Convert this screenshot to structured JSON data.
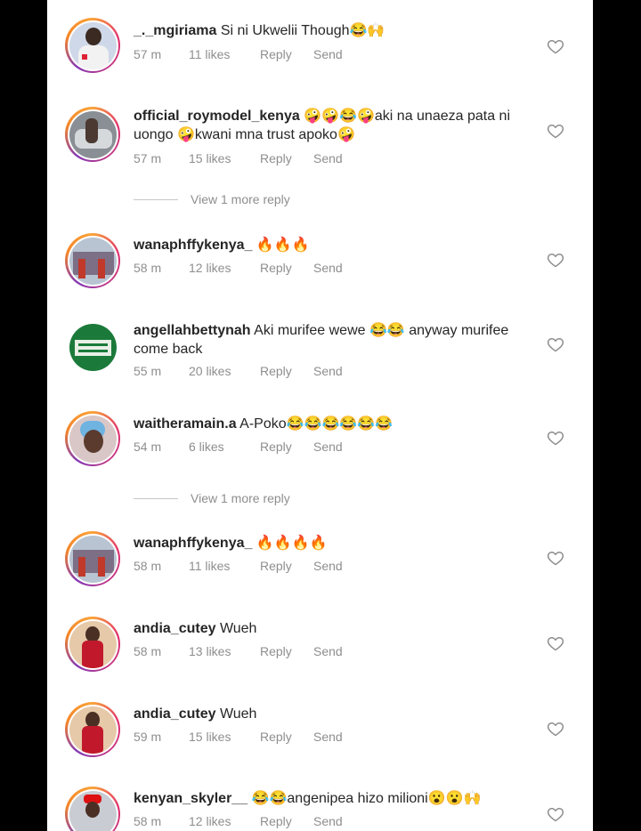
{
  "comments": [
    {
      "username": "_._mgiriama",
      "text": "Si ni Ukwelii Though😂🙌",
      "time": "57 m",
      "likes": "11 likes",
      "reply": "Reply",
      "send": "Send"
    },
    {
      "username": "official_roymodel_kenya",
      "text": "🤪🤪😂🤪aki na unaeza pata ni uongo 🤪kwani mna trust apoko🤪",
      "time": "57 m",
      "likes": "15 likes",
      "reply": "Reply",
      "send": "Send",
      "view_more": "View 1 more reply"
    },
    {
      "username": "wanaphffykenya_",
      "text": "🔥🔥🔥",
      "time": "58 m",
      "likes": "12 likes",
      "reply": "Reply",
      "send": "Send"
    },
    {
      "username": "angellahbettynah",
      "text": "Aki murifee wewe 😂😂 anyway murifee come back",
      "time": "55 m",
      "likes": "20 likes",
      "reply": "Reply",
      "send": "Send"
    },
    {
      "username": "waitheramain.a",
      "text": "A-Poko😂😂😂😂😂😂",
      "time": "54 m",
      "likes": "6 likes",
      "reply": "Reply",
      "send": "Send",
      "view_more": "View 1 more reply"
    },
    {
      "username": "wanaphffykenya_",
      "text": "🔥🔥🔥🔥",
      "time": "58 m",
      "likes": "11 likes",
      "reply": "Reply",
      "send": "Send"
    },
    {
      "username": "andia_cutey",
      "text": "Wueh",
      "time": "58 m",
      "likes": "13 likes",
      "reply": "Reply",
      "send": "Send"
    },
    {
      "username": "andia_cutey",
      "text": "Wueh",
      "time": "59 m",
      "likes": "15 likes",
      "reply": "Reply",
      "send": "Send"
    },
    {
      "username": "kenyan_skyler__",
      "text": "😂😂angenipea hizo milioni😮😮🙌",
      "time": "58 m",
      "likes": "12 likes",
      "reply": "Reply",
      "send": "Send"
    }
  ],
  "icons": {
    "heart": "heart-outline-icon"
  },
  "colors": {
    "meta": "#8e8e8e",
    "text": "#262626",
    "ring_start": "#f9a33a",
    "ring_end": "#c13584"
  }
}
